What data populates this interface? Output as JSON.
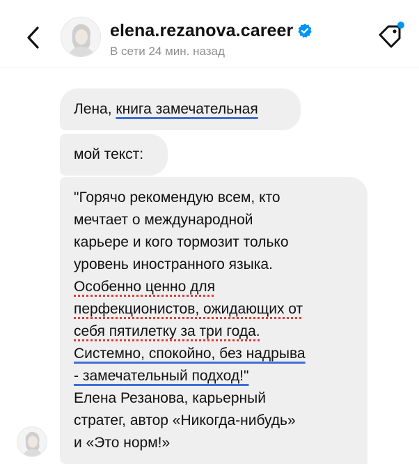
{
  "header": {
    "username": "elena.rezanova.career",
    "status": "В сети 24 мин. назад",
    "accent_color": "#0095f6",
    "back_icon": "chevron-left-icon",
    "tag_icon": "tag-icon"
  },
  "messages": [
    {
      "parts": [
        "Лена, ",
        "книга замечательная"
      ]
    },
    {
      "text": "мой текст:"
    },
    {
      "lines": [
        "\"Горячо рекомендую всем, кто",
        "мечтает о международной",
        "карьере и кого тормозит только",
        "уровень иностранного языка.",
        "Особенно ценно для",
        "перфекционистов, ожидающих от",
        "себя пятилетку за три года.",
        "Системно, спокойно, без надрыва",
        "- замечательный подход!\"",
        "Елена Резанова, карьерный",
        "стратег, автор «Никогда-нибудь»",
        "и «Это норм!»"
      ]
    }
  ],
  "annotation_colors": {
    "blue": "#3f6fd6",
    "red": "#e23a35"
  }
}
